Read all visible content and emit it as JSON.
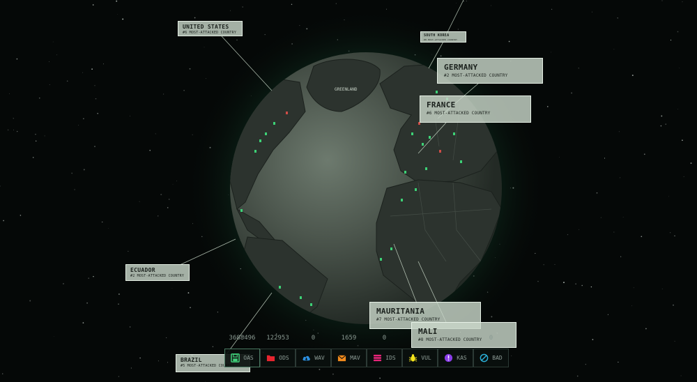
{
  "map_labels": {
    "greenland": "GREENLAND"
  },
  "labels": [
    {
      "id": "united-states",
      "name": "UNITED STATES",
      "rank": "#6 MOST-ATTACKED COUNTRY"
    },
    {
      "id": "south-korea",
      "name": "SOUTH KOREA",
      "rank": "#8 MOST-ATTACKED COUNTRY"
    },
    {
      "id": "germany",
      "name": "GERMANY",
      "rank": "#2 MOST-ATTACKED COUNTRY"
    },
    {
      "id": "france",
      "name": "FRANCE",
      "rank": "#6 MOST-ATTACKED COUNTRY"
    },
    {
      "id": "ecuador",
      "name": "ECUADOR",
      "rank": "#2 MOST-ATTACKED COUNTRY"
    },
    {
      "id": "mauritania",
      "name": "MAURITANIA",
      "rank": "#7 MOST-ATTACKED COUNTRY"
    },
    {
      "id": "mali",
      "name": "MALI",
      "rank": "#8 MOST-ATTACKED COUNTRY"
    },
    {
      "id": "brazil",
      "name": "BRAZIL",
      "rank": "#5 MOST-ATTACKED COUNTRY"
    }
  ],
  "counters": [
    "3688496",
    "122953",
    "0",
    "1659",
    "0",
    "",
    "",
    "0"
  ],
  "toolbar": [
    {
      "id": "oas",
      "label": "OAS",
      "icon": "save-icon",
      "color": "#3fd17a"
    },
    {
      "id": "ods",
      "label": "ODS",
      "icon": "folder-icon",
      "color": "#e8252f"
    },
    {
      "id": "wav",
      "label": "WAV",
      "icon": "cloud-icon",
      "color": "#2b8fe0"
    },
    {
      "id": "mav",
      "label": "MAV",
      "icon": "mail-icon",
      "color": "#f28a1c"
    },
    {
      "id": "ids",
      "label": "IDS",
      "icon": "ids-icon",
      "color": "#e8257a"
    },
    {
      "id": "vul",
      "label": "VUL",
      "icon": "bug-icon",
      "color": "#f2e21c"
    },
    {
      "id": "kas",
      "label": "KAS",
      "icon": "alert-icon",
      "color": "#8a3de8"
    },
    {
      "id": "bad",
      "label": "BAD",
      "icon": "block-icon",
      "color": "#2bb0d8"
    }
  ]
}
